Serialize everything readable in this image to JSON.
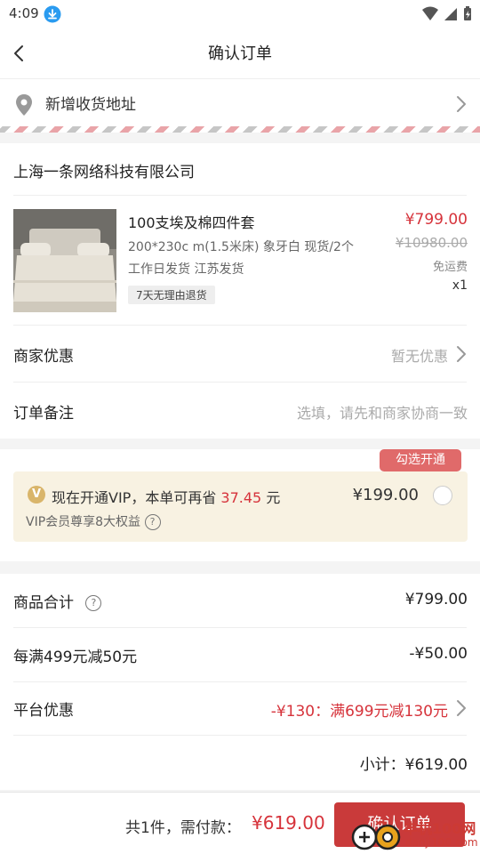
{
  "status_bar": {
    "time": "4:09"
  },
  "nav": {
    "title": "确认订单"
  },
  "address": {
    "label": "新增收货地址"
  },
  "order": {
    "merchant": "上海一条网络科技有限公司",
    "product": {
      "name": "100支埃及棉四件套",
      "spec": "200*230c m(1.5米床)  象牙白  现货/2个",
      "shipping": "工作日发货  江苏发货",
      "tag": "7天无理由退货",
      "price": "¥799.00",
      "original_price": "¥10980.00",
      "shipping_fee": "免运费",
      "quantity": "x1"
    },
    "merchant_discount": {
      "label": "商家优惠",
      "value": "暂无优惠"
    },
    "remark": {
      "label": "订单备注",
      "placeholder": "选填，请先和商家协商一致"
    }
  },
  "vip": {
    "bubble": "勾选开通",
    "badge": "V",
    "line_prefix": "现在开通VIP，本单可再省",
    "save_amount": "37.45",
    "line_suffix": "元",
    "benefits": "VIP会员尊享8大权益",
    "price": "¥199.00"
  },
  "summary": {
    "goods_total_label": "商品合计",
    "goods_total_value": "¥799.00",
    "promo_label": "每满499元减50元",
    "promo_value": "-¥50.00",
    "platform_label": "平台优惠",
    "platform_value": "-¥130：满699元减130元",
    "subtotal": "小计：¥619.00"
  },
  "bottom": {
    "total_label": "共1件，需付款：",
    "total_amount": "¥619.00",
    "confirm_button": "确认订单"
  },
  "watermark": {
    "text1": "丰机100网",
    "text2": "danji100.com"
  },
  "colors": {
    "accent_red": "#d6333b",
    "button_red": "#c93a3a",
    "vip_bg": "#f8f2e2",
    "stripe_red": "#e9a4a8"
  }
}
